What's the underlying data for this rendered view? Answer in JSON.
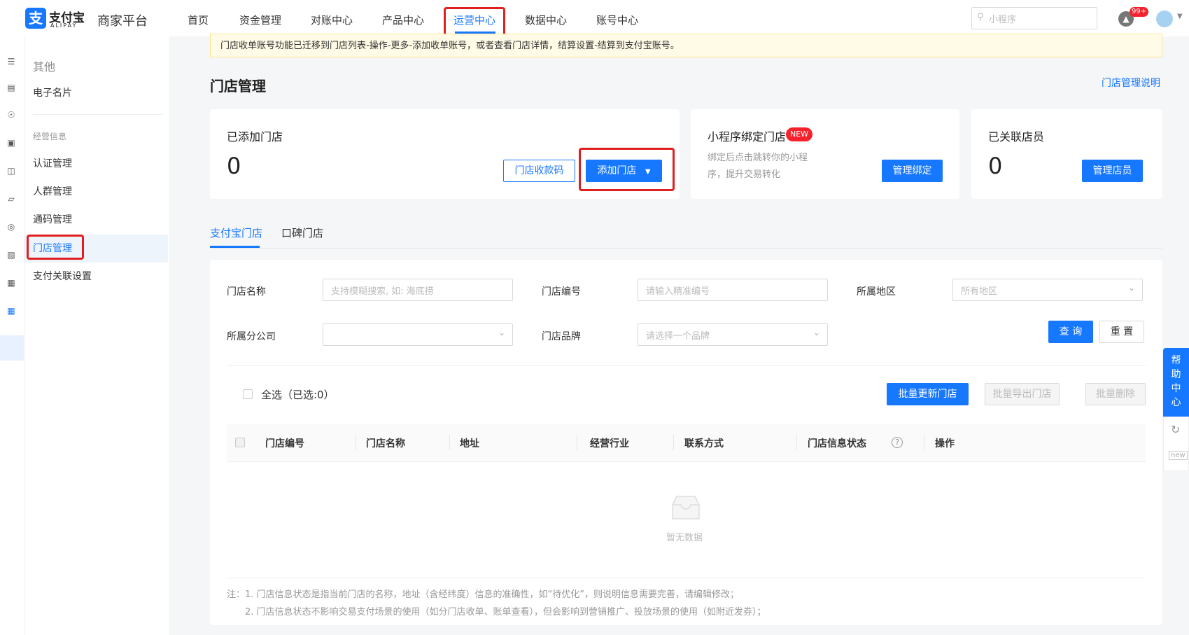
{
  "brand": {
    "cn": "支付宝",
    "en": "ALIPAY",
    "logo_glyph": "支",
    "platform": "商家平台"
  },
  "nav": {
    "items": [
      "首页",
      "资金管理",
      "对账中心",
      "产品中心",
      "运营中心",
      "数据中心",
      "账号中心"
    ],
    "active": "运营中心"
  },
  "search": {
    "placeholder": "小程序"
  },
  "notifications": {
    "badge": "99+"
  },
  "sidebar": {
    "group1": "其他",
    "item_card": "电子名片",
    "group2": "经营信息",
    "items": [
      "认证管理",
      "人群管理",
      "通码管理",
      "门店管理",
      "支付关联设置"
    ],
    "active": "门店管理"
  },
  "notice": "门店收单账号功能已迁移到门店列表-操作-更多-添加收单账号，或者查看门店详情，结算设置-结算到支付宝账号。",
  "page": {
    "title": "门店管理",
    "help_link": "门店管理说明"
  },
  "cards": {
    "added": {
      "title": "已添加门店",
      "count": "0",
      "qr_btn": "门店收款码",
      "add_btn": "添加门店"
    },
    "miniapp": {
      "title": "小程序绑定门店",
      "badge": "NEW",
      "desc": "绑定后点击跳转你的小程序，提升交易转化",
      "btn": "管理绑定"
    },
    "staff": {
      "title": "已关联店员",
      "count": "0",
      "btn": "管理店员"
    }
  },
  "tabs": [
    "支付宝门店",
    "口碑门店"
  ],
  "filters": {
    "name_label": "门店名称",
    "name_ph": "支持模糊搜索, 如: 海底捞",
    "code_label": "门店编号",
    "code_ph": "请输入精准编号",
    "region_label": "所属地区",
    "region_ph": "所有地区",
    "branch_label": "所属分公司",
    "brand_label": "门店品牌",
    "brand_ph": "请选择一个品牌",
    "query_btn": "查 询",
    "reset_btn": "重 置"
  },
  "batch": {
    "select_all": "全选（已选:0）",
    "update_btn": "批量更新门店",
    "export_btn": "批量导出门店",
    "delete_btn": "批量删除"
  },
  "table": {
    "columns": [
      "门店编号",
      "门店名称",
      "地址",
      "经营行业",
      "联系方式",
      "门店信息状态",
      "操作"
    ],
    "empty": "暂无数据"
  },
  "notes": {
    "line1": "注：1. 门店信息状态是指当前门店的名称，地址（含经纬度）信息的准确性，如“待优化”，则说明信息需要完善，请编辑修改；",
    "line2": "2. 门店信息状态不影响交易支付场景的使用（如分门店收单、账单查看），但会影响到营销推广、投放场景的使用（如附近发券）；"
  },
  "help_float": {
    "chars": [
      "帮",
      "助",
      "中",
      "心"
    ],
    "new_label": "new"
  },
  "colors": {
    "primary": "#1677ff",
    "highlight": "#e02020"
  }
}
